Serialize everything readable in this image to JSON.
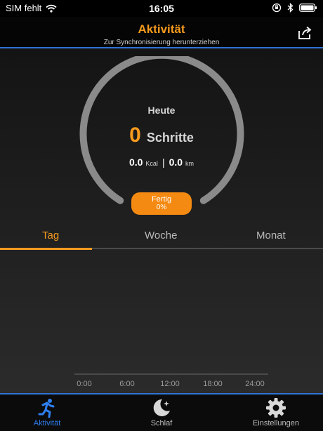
{
  "status_bar": {
    "carrier": "SIM fehlt",
    "time": "16:05"
  },
  "header": {
    "title": "Aktivität",
    "subtitle": "Zur Synchronisierung herunterziehen"
  },
  "summary": {
    "period_label": "Heute",
    "steps_value": "0",
    "steps_unit": "Schritte",
    "kcal_value": "0.0",
    "kcal_unit": "Kcal",
    "km_value": "0.0",
    "km_unit": "km",
    "separator": "|",
    "progress_label": "Fertig",
    "progress_value": "0%",
    "progress_fraction": 0
  },
  "tabs": [
    {
      "label": "Tag",
      "active": true
    },
    {
      "label": "Woche",
      "active": false
    },
    {
      "label": "Monat",
      "active": false
    }
  ],
  "chart": {
    "x_ticks": [
      "0:00",
      "6:00",
      "12:00",
      "18:00",
      "24:00"
    ]
  },
  "tab_bar": [
    {
      "label": "Aktivität",
      "icon": "running-icon",
      "active": true
    },
    {
      "label": "Schlaf",
      "icon": "moon-icon",
      "active": false
    },
    {
      "label": "Einstellungen",
      "icon": "gear-icon",
      "active": false
    }
  ],
  "colors": {
    "accent": "#f59a1e",
    "blue": "#2f72d6",
    "ring": "#8a8a8a"
  }
}
